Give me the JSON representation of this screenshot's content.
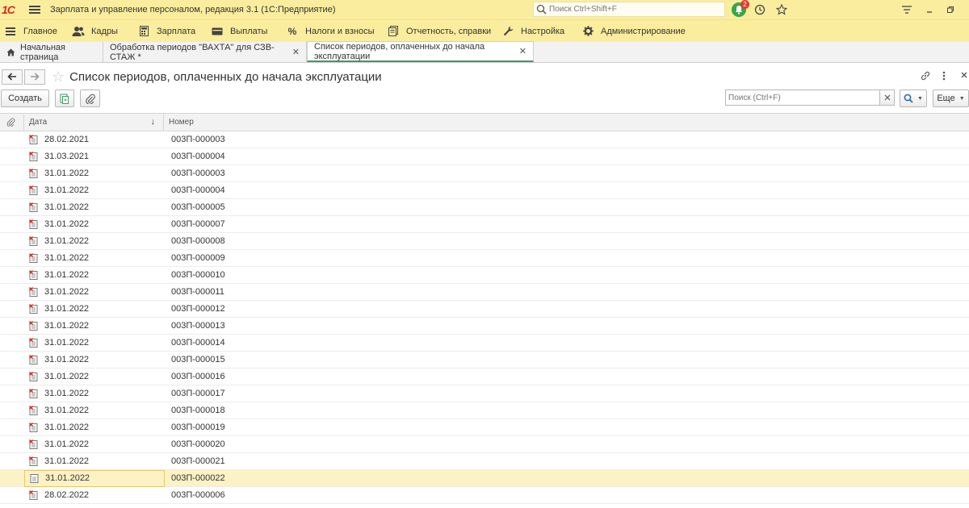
{
  "app": {
    "logo": "1С",
    "title": "Зарплата и управление персоналом, редакция 3.1  (1С:Предприятие)",
    "search_placeholder": "Поиск Ctrl+Shift+F",
    "notification_count": "2"
  },
  "menu": [
    {
      "label": "Главное",
      "icon": "hamburger-icon"
    },
    {
      "label": "Кадры",
      "icon": "people-icon"
    },
    {
      "label": "Зарплата",
      "icon": "calculator-icon"
    },
    {
      "label": "Выплаты",
      "icon": "wallet-icon"
    },
    {
      "label": "Налоги и взносы",
      "icon": "percent-icon"
    },
    {
      "label": "Отчетность, справки",
      "icon": "reports-icon"
    },
    {
      "label": "Настройка",
      "icon": "wrench-icon"
    },
    {
      "label": "Администрирование",
      "icon": "gear-icon"
    }
  ],
  "tabs": [
    {
      "label": "Начальная страница"
    },
    {
      "label": "Обработка периодов  \"ВАХТА\" для СЗВ-СТАЖ  *"
    },
    {
      "label": "Список периодов, оплаченных до начала эксплуатации"
    }
  ],
  "form": {
    "title": "Список периодов, оплаченных до начала эксплуатации",
    "create_label": "Создать",
    "search_placeholder": "Поиск (Ctrl+F)",
    "more_label": "Еще"
  },
  "table": {
    "columns": [
      "Дата",
      "Номер"
    ],
    "rows": [
      {
        "date": "28.02.2021",
        "number": "003П-000003"
      },
      {
        "date": "31.03.2021",
        "number": "003П-000004"
      },
      {
        "date": "31.01.2022",
        "number": "003П-000003"
      },
      {
        "date": "31.01.2022",
        "number": "003П-000004"
      },
      {
        "date": "31.01.2022",
        "number": "003П-000005"
      },
      {
        "date": "31.01.2022",
        "number": "003П-000007"
      },
      {
        "date": "31.01.2022",
        "number": "003П-000008"
      },
      {
        "date": "31.01.2022",
        "number": "003П-000009"
      },
      {
        "date": "31.01.2022",
        "number": "003П-000010"
      },
      {
        "date": "31.01.2022",
        "number": "003П-000011"
      },
      {
        "date": "31.01.2022",
        "number": "003П-000012"
      },
      {
        "date": "31.01.2022",
        "number": "003П-000013"
      },
      {
        "date": "31.01.2022",
        "number": "003П-000014"
      },
      {
        "date": "31.01.2022",
        "number": "003П-000015"
      },
      {
        "date": "31.01.2022",
        "number": "003П-000016"
      },
      {
        "date": "31.01.2022",
        "number": "003П-000017"
      },
      {
        "date": "31.01.2022",
        "number": "003П-000018"
      },
      {
        "date": "31.01.2022",
        "number": "003П-000019"
      },
      {
        "date": "31.01.2022",
        "number": "003П-000020"
      },
      {
        "date": "31.01.2022",
        "number": "003П-000021"
      },
      {
        "date": "31.01.2022",
        "number": "003П-000022"
      },
      {
        "date": "28.02.2022",
        "number": "003П-000006"
      }
    ]
  },
  "colors": {
    "header_bg": "#fbed9e",
    "accent_green": "#3f9a6a",
    "selected_row": "#fcf2c5",
    "deleted_mark": "#d52b1e"
  }
}
